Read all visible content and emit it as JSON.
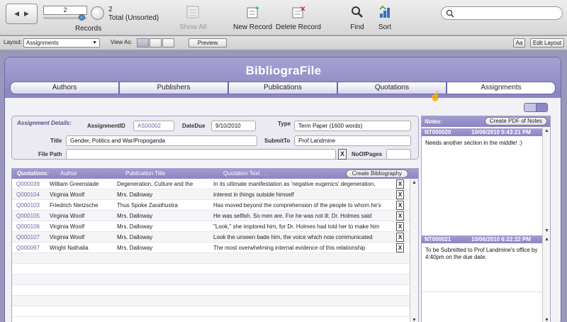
{
  "toolbar": {
    "record_value": "2",
    "records_label": "Records",
    "total_count": "2",
    "total_label": "Total (Unsorted)",
    "show_all_label": "Show All",
    "new_record_label": "New Record",
    "delete_record_label": "Delete Record",
    "find_label": "Find",
    "sort_label": "Sort",
    "search_placeholder": ""
  },
  "layoutbar": {
    "layout_label": "Layout:",
    "layout_value": "Assignments",
    "view_as_label": "View As:",
    "preview_label": "Preview",
    "aa_label": "Aa",
    "edit_layout_label": "Edit Layout"
  },
  "app": {
    "title": "BibliograFile",
    "tabs": [
      "Authors",
      "Publishers",
      "Publications",
      "Quotations",
      "Assignments"
    ]
  },
  "assignment": {
    "section_label": "Assignment Details:",
    "id_label": "AssignmentID",
    "id_value": "AS00002",
    "datedue_label": "DateDue",
    "datedue_value": "9/10/2010",
    "type_label": "Type",
    "type_value": "Term Paper (1600 words)",
    "title_label": "Title",
    "title_value": "Gender, Politics and War/Propoganda",
    "submitto_label": "SubmitTo",
    "submitto_value": "Prof Landmine",
    "filepath_label": "File Path",
    "filepath_value": "",
    "clear_label": "X",
    "pages_label": "NoOfPages",
    "pages_value": ""
  },
  "quotations": {
    "section_label": "Quotations:",
    "col_author": "Author",
    "col_pub": "Publication Title",
    "col_text": "Quotation Text . . .",
    "create_bib_label": "Create Bibliography",
    "delete_label": "X",
    "rows": [
      {
        "id": "Q000039",
        "author": "William Greenslade",
        "pub": "Degeneration, Culture and the",
        "text": "In its ultimate manifestation as 'negative eugenics' degeneration,"
      },
      {
        "id": "Q000104",
        "author": "Virginia Woolf",
        "pub": "Mrs. Dalloway",
        "text": "interest in things outside himself"
      },
      {
        "id": "Q000103",
        "author": "Friedrich Nietzsche",
        "pub": "Thus Spoke Zarathustra",
        "text": "Has moved beyond the comprehension of the people to whom he's"
      },
      {
        "id": "Q000105",
        "author": "Virginia Woolf",
        "pub": "Mrs. Dalloway",
        "text": "He was selfish. So men are. For he was not ill. Dr. Holmes said"
      },
      {
        "id": "Q000106",
        "author": "Virginia Woolf",
        "pub": "Mrs. Dalloway",
        "text": "\"Look,\" she implored him, for Dr. Holmes had told her to make him"
      },
      {
        "id": "Q000107",
        "author": "Virginia Woolf",
        "pub": "Mrs. Dalloway",
        "text": "Look the unseen bade him, the voice which now communicated"
      },
      {
        "id": "Q000097",
        "author": "Wright Nathalia",
        "pub": "Mrs. Dalloway",
        "text": "The most overwhelming internal evidence of this relationship"
      }
    ]
  },
  "notes": {
    "section_label": "Notes:",
    "pdf_label": "Create PDF of Notes",
    "items": [
      {
        "id": "NT000020",
        "date": "10/06/2010 5:43:21 PM",
        "text": "Needs another section in the middle! :)"
      },
      {
        "id": "NT000021",
        "date": "10/06/2010 6:22:22 PM",
        "text": "To be Submitted to Prof Landmine's office by 4:40pm on the due date."
      }
    ]
  },
  "colors": {
    "accent": "#8a84c2",
    "panel": "#ebeaf2",
    "id_text": "#6b67a3"
  }
}
